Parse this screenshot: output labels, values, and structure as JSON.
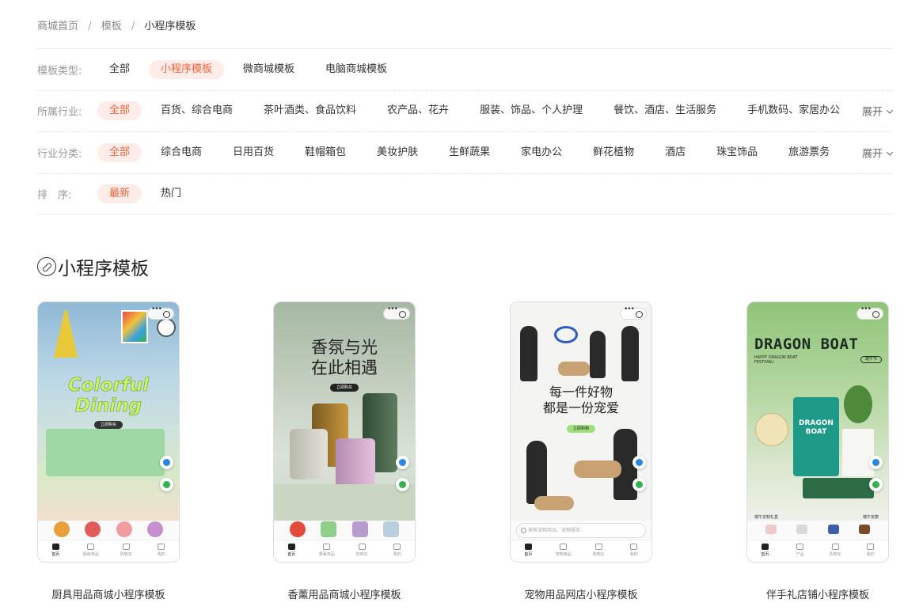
{
  "breadcrumb": {
    "home": "商城首页",
    "section": "模板",
    "current": "小程序模板",
    "separator": "/"
  },
  "filters": {
    "type": {
      "label": "模板类型:",
      "options": [
        "全部",
        "小程序模板",
        "微商城模板",
        "电脑商城模板"
      ]
    },
    "industry": {
      "label": "所属行业:",
      "options": [
        "全部",
        "百货、综合电商",
        "茶叶酒类、食品饮料",
        "农产品、花卉",
        "服装、饰品、个人护理",
        "餐饮、酒店、生活服务",
        "手机数码、家居办公"
      ],
      "expand": "展开"
    },
    "category": {
      "label": "行业分类:",
      "options": [
        "全部",
        "综合电商",
        "日用百货",
        "鞋帽箱包",
        "美妆护肤",
        "生鲜蔬果",
        "家电办公",
        "鲜花植物",
        "酒店",
        "珠宝饰品",
        "旅游票务"
      ],
      "expand": "展开"
    },
    "sort": {
      "label": "排　序:",
      "options": [
        "最新",
        "热门"
      ]
    }
  },
  "section_title": "小程序模板",
  "templates": [
    {
      "title": "厨具用品商城小程序模板",
      "hero_line1": "Colorful",
      "hero_line2": "Dining",
      "cta": "立即购买",
      "tabs": [
        "首页",
        "厨房用品",
        "购物车",
        "我的"
      ]
    },
    {
      "title": "香薰用品商城小程序模板",
      "hero_line1": "香氛与光",
      "hero_line2": "在此相遇",
      "cta": "立即购买",
      "tabs": [
        "首页",
        "香薰用品",
        "购物车",
        "我的"
      ]
    },
    {
      "title": "宠物用品网店小程序模板",
      "hero_line1": "每一件好物",
      "hero_line2": "都是一份宠爱",
      "cta": "立即购物",
      "search": "搜索宠物用品、宠物服务...",
      "tabs": [
        "首页",
        "宠物用品",
        "购物车",
        "我的"
      ]
    },
    {
      "title": "伴手礼店铺小程序模板",
      "hero_line1": "DRAGON BOAT",
      "hero_line2": "HAPPY DRAGON BOAT FESTIVAL!",
      "badge": "端午节",
      "bag_text": "DRAGON BOAT",
      "caption_left": "端午定制礼盒",
      "caption_right": "端午安康",
      "tabs": [
        "首页",
        "产品",
        "购物车",
        "我的"
      ]
    }
  ],
  "colors": {
    "accent": "#f0643c",
    "chip_bg": "#fdece7"
  }
}
